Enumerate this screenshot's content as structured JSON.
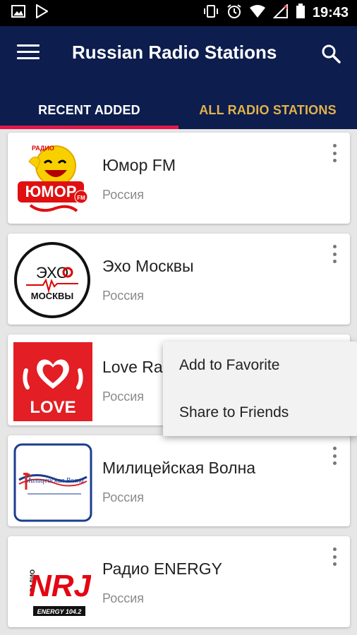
{
  "status_bar": {
    "time": "19:43",
    "left_icons": [
      "image-icon",
      "play-store-icon"
    ],
    "right_icons": [
      "vibrate-icon",
      "alarm-icon",
      "wifi-icon",
      "signal-icon",
      "battery-icon"
    ]
  },
  "app_bar": {
    "title": "Russian Radio Stations",
    "background": "#0c1d4e",
    "menu_icon": "hamburger-menu-icon",
    "search_icon": "search-icon"
  },
  "tabs": [
    {
      "label": "RECENT ADDED",
      "selected": true
    },
    {
      "label": "ALL RADIO STATIONS",
      "selected": false
    }
  ],
  "accent": {
    "indicator": "#e5174a",
    "tab_inactive_text": "#e3b24a"
  },
  "stations": [
    {
      "name": "Юмор FM",
      "country": "Россия",
      "logo": "humor-fm-logo",
      "logo_text": "ЮМОР"
    },
    {
      "name": "Эхо Москвы",
      "country": "Россия",
      "logo": "echo-moskvy-logo",
      "logo_text_top": "ЭХО",
      "logo_text_bottom": "МОСКВЫ"
    },
    {
      "name": "Love Ra",
      "country": "Россия",
      "logo": "love-radio-logo",
      "logo_text": "LOVE"
    },
    {
      "name": "Милицейская Волна",
      "country": "Россия",
      "logo": "militseyskaya-volna-logo"
    },
    {
      "name": "Радио ENERGY",
      "country": "Россия",
      "logo": "nrj-logo",
      "logo_text": "NRJ",
      "logo_sub": "ENERGY 104.2"
    }
  ],
  "popup_menu": {
    "items": [
      "Add to Favorite",
      "Share to Friends"
    ]
  }
}
